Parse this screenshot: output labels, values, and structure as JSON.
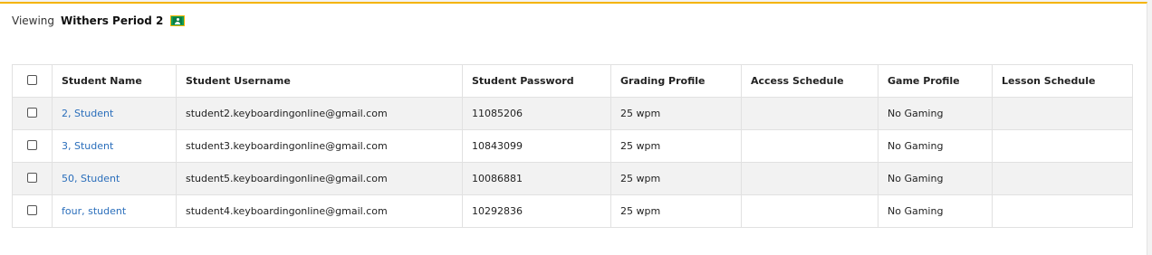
{
  "header": {
    "viewing_label": "Viewing",
    "class_name": "Withers Period 2",
    "class_icon": "google-classroom-icon"
  },
  "table": {
    "columns": [
      "Student Name",
      "Student Username",
      "Student Password",
      "Grading Profile",
      "Access Schedule",
      "Game Profile",
      "Lesson Schedule"
    ],
    "rows": [
      {
        "name": "2, Student",
        "username": "student2.keyboardingonline@gmail.com",
        "password": "11085206",
        "grading": "25 wpm",
        "access": "",
        "game": "No Gaming",
        "lesson": ""
      },
      {
        "name": "3, Student",
        "username": "student3.keyboardingonline@gmail.com",
        "password": "10843099",
        "grading": "25 wpm",
        "access": "",
        "game": "No Gaming",
        "lesson": ""
      },
      {
        "name": "50, Student",
        "username": "student5.keyboardingonline@gmail.com",
        "password": "10086881",
        "grading": "25 wpm",
        "access": "",
        "game": "No Gaming",
        "lesson": ""
      },
      {
        "name": "four, student",
        "username": "student4.keyboardingonline@gmail.com",
        "password": "10292836",
        "grading": "25 wpm",
        "access": "",
        "game": "No Gaming",
        "lesson": ""
      }
    ]
  },
  "colors": {
    "accent_border": "#f4b400",
    "link": "#2a6ebb",
    "stripe": "#f2f2f2"
  }
}
